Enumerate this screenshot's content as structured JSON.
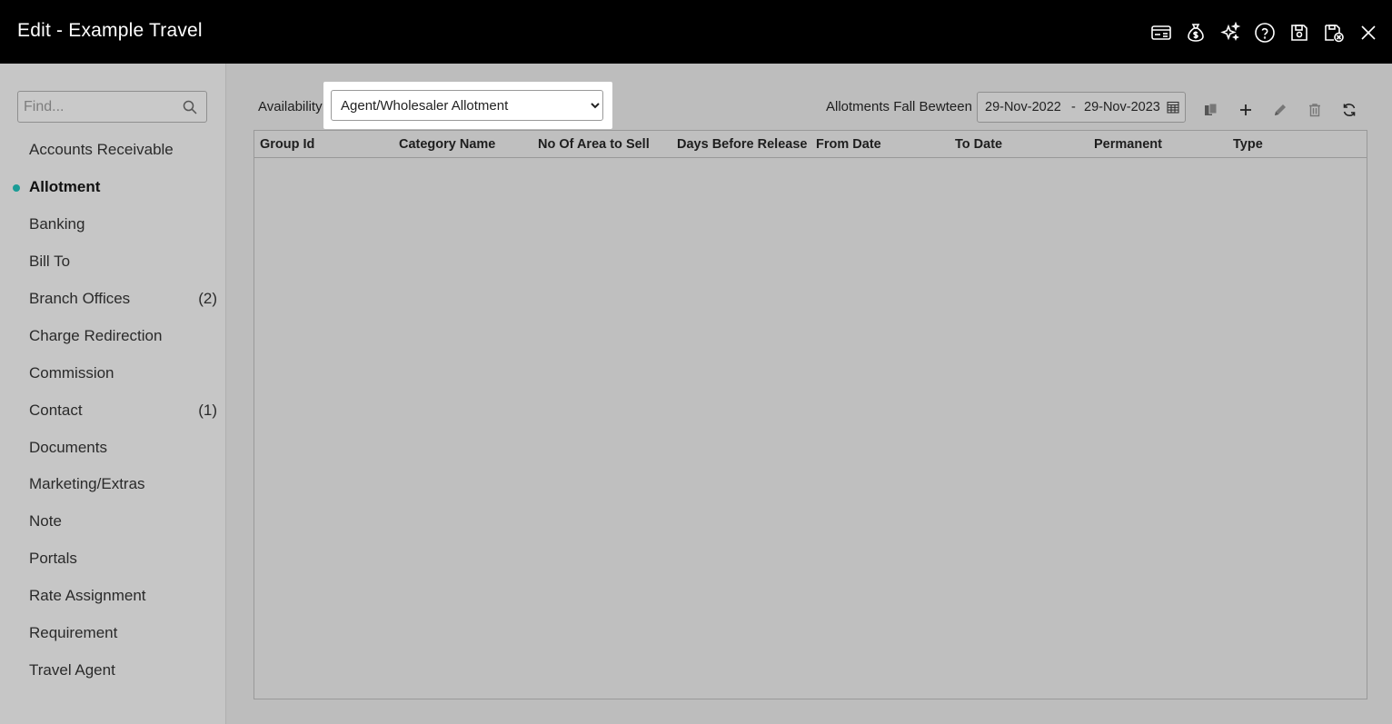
{
  "window": {
    "title": "Edit - Example Travel",
    "icons": [
      "card-icon",
      "money-bag-icon",
      "sparkle-icon",
      "help-icon",
      "save-icon",
      "save-close-icon",
      "close-icon"
    ]
  },
  "sidebar": {
    "search_placeholder": "Find...",
    "items": [
      {
        "label": "Accounts Receivable",
        "count": ""
      },
      {
        "label": "Allotment",
        "count": "",
        "active": true
      },
      {
        "label": "Banking",
        "count": ""
      },
      {
        "label": "Bill To",
        "count": ""
      },
      {
        "label": "Branch Offices",
        "count": "(2)"
      },
      {
        "label": "Charge Redirection",
        "count": ""
      },
      {
        "label": "Commission",
        "count": ""
      },
      {
        "label": "Contact",
        "count": "(1)"
      },
      {
        "label": "Documents",
        "count": ""
      },
      {
        "label": "Marketing/Extras",
        "count": ""
      },
      {
        "label": "Note",
        "count": ""
      },
      {
        "label": "Portals",
        "count": ""
      },
      {
        "label": "Rate Assignment",
        "count": ""
      },
      {
        "label": "Requirement",
        "count": ""
      },
      {
        "label": "Travel Agent",
        "count": ""
      }
    ]
  },
  "filters": {
    "availability_label": "Availability",
    "availability_value": "Agent/Wholesaler Allotment",
    "range_label": "Allotments Fall Bewteen",
    "date_from": "29-Nov-2022",
    "date_sep": "-",
    "date_to": "29-Nov-2023"
  },
  "toolbar": {
    "icons": [
      "copy-icon",
      "add-icon",
      "edit-icon",
      "delete-icon",
      "refresh-icon"
    ]
  },
  "table": {
    "columns": [
      "Group Id",
      "Category Name",
      "No Of Area to Sell",
      "Days Before Release",
      "From Date",
      "To Date",
      "Permanent",
      "Type"
    ],
    "rows": []
  },
  "colors": {
    "titlebar": "#000000",
    "sidebar_bg": "#c6c6c6",
    "main_bg": "#bdbdbd",
    "active_dot": "#1a9c96"
  }
}
